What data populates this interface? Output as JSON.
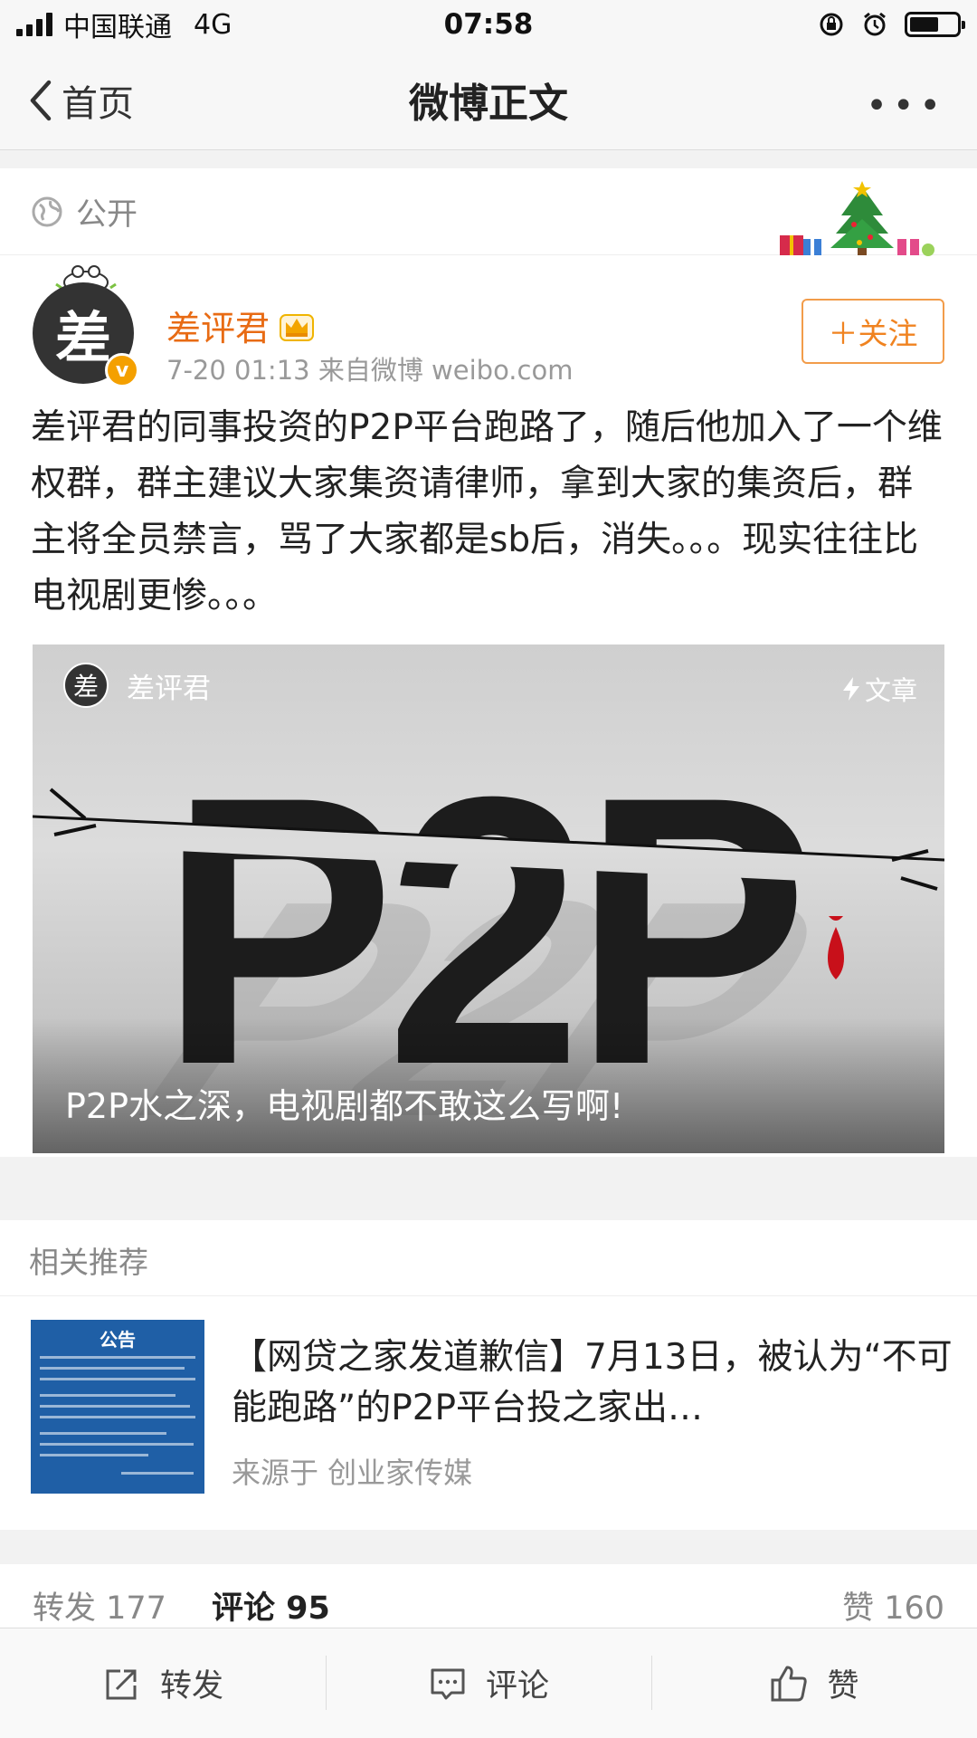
{
  "status": {
    "carrier": "中国联通",
    "network": "4G",
    "time": "07:58"
  },
  "nav": {
    "back_label": "首页",
    "title": "微博正文",
    "more_label": "•••"
  },
  "post": {
    "visibility": "公开",
    "author": {
      "name": "差评君",
      "avatar_char": "差",
      "verified_badge": "v",
      "meta": "7-20 01:13  来自微博 weibo.com"
    },
    "follow_label": "＋关注",
    "text": "差评君的同事投资的P2P平台跑路了，随后他加入了一个维权群，群主建议大家集资请律师，拿到大家的集资后，群主将全员禁言，骂了大家都是sb后，消失。。。现实往往比电视剧更惨。。。",
    "article": {
      "author_name": "差评君",
      "avatar_char": "差",
      "type_label": "文章",
      "image_text": "P2P",
      "caption": "P2P水之深，电视剧都不敢这么写啊!"
    }
  },
  "related": {
    "section_title": "相关推荐",
    "item": {
      "thumb_title": "公告",
      "title": "【网贷之家发道歉信】7月13日，被认为“不可能跑路”的P2P平台投之家出…",
      "source": "来源于 创业家传媒"
    }
  },
  "counts": {
    "repost": "转发 177",
    "comment": "评论 95",
    "like": "赞 160"
  },
  "bottom_bar": {
    "repost": "转发",
    "comment": "评论",
    "like": "赞"
  },
  "colors": {
    "accent_orange": "#f08320",
    "name_orange": "#e86b14",
    "verified_yellow": "#f4a000",
    "blood_red": "#c8101a"
  }
}
